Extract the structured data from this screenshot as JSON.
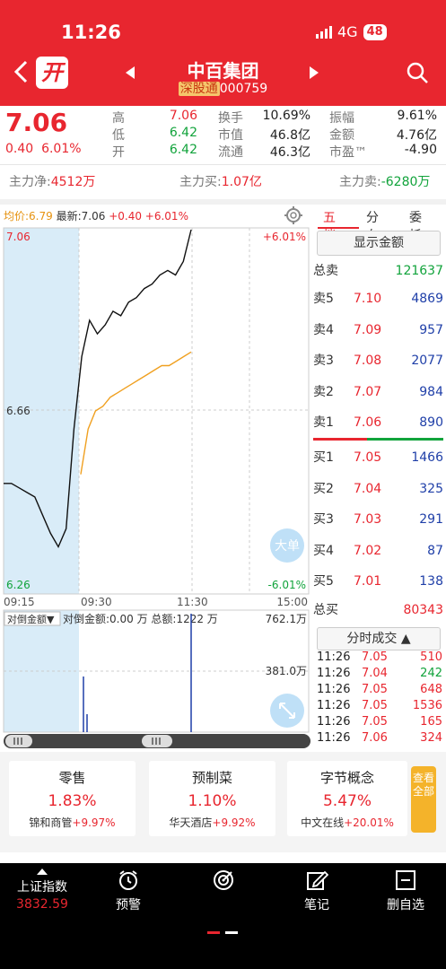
{
  "status": {
    "time": "11:26",
    "network": "4G",
    "battery": "48"
  },
  "header": {
    "logo": "开",
    "name": "中百集团",
    "exchange": "深股通",
    "code": "000759"
  },
  "quote": {
    "price": "7.06",
    "change": "0.40",
    "change_pct": "6.01%",
    "stats": [
      {
        "label": "高",
        "value": "7.06",
        "color": "red"
      },
      {
        "label": "换手",
        "value": "10.69%",
        "color": "black"
      },
      {
        "label": "振幅",
        "value": "9.61%",
        "color": "black"
      },
      {
        "label": "低",
        "value": "6.42",
        "color": "green"
      },
      {
        "label": "市值",
        "value": "46.8亿",
        "color": "black"
      },
      {
        "label": "金额",
        "value": "4.76亿",
        "color": "black"
      },
      {
        "label": "开",
        "value": "6.42",
        "color": "green"
      },
      {
        "label": "流通",
        "value": "46.3亿",
        "color": "black"
      },
      {
        "label": "市盈™",
        "value": "-4.90",
        "color": "black"
      }
    ]
  },
  "capital_flow": {
    "net_label": "主力净:",
    "net_value": "4512万",
    "buy_label": "主力买:",
    "buy_value": "1.07亿",
    "sell_label": "主力卖:",
    "sell_value": "-6280万"
  },
  "chart": {
    "avg_label": "均价:6.79",
    "latest_label": "最新:7.06",
    "chg_label": "+0.40",
    "pct_label": "+6.01%",
    "y_top": "7.06",
    "y_mid": "6.66",
    "y_bottom": "6.26",
    "pct_top": "+6.01%",
    "pct_bottom": "-6.01%",
    "x_labels": [
      "09:15",
      "09:30",
      "11:30",
      "15:00"
    ],
    "enlarge_label": "大单",
    "sub_selector": "对倒金额▼",
    "sub_text": "对倒金额:0.00 万 总额:1222 万",
    "sub_y_top": "762.1万",
    "sub_y_mid": "381.0万"
  },
  "chart_data": {
    "type": "line",
    "title": "",
    "xlabel": "",
    "ylabel": "",
    "ylim": [
      6.26,
      7.06
    ],
    "x_ticks": [
      "09:15",
      "09:30",
      "11:30",
      "15:00"
    ],
    "series": [
      {
        "values": [
          6.5,
          6.5,
          6.49,
          6.48,
          6.47,
          6.43,
          6.39,
          6.36,
          6.4,
          6.62,
          6.78,
          6.86,
          6.83,
          6.85,
          6.88,
          6.87,
          6.9,
          6.91,
          6.93,
          6.94,
          6.96,
          6.97,
          6.96,
          6.99,
          7.06
        ]
      },
      {
        "values": [
          6.52,
          6.62,
          6.66,
          6.67,
          6.69,
          6.7,
          6.71,
          6.72,
          6.73,
          6.74,
          6.75,
          6.76,
          6.76,
          6.77,
          6.78,
          6.79
        ]
      }
    ]
  },
  "orderbook": {
    "tabs": [
      "五档",
      "分布",
      "委托"
    ],
    "show_amount": "显示金额",
    "total_sell_label": "总卖",
    "total_sell": "121637",
    "asks": [
      {
        "label": "卖5",
        "price": "7.10",
        "vol": "4869"
      },
      {
        "label": "卖4",
        "price": "7.09",
        "vol": "957"
      },
      {
        "label": "卖3",
        "price": "7.08",
        "vol": "2077"
      },
      {
        "label": "卖2",
        "price": "7.07",
        "vol": "984"
      },
      {
        "label": "卖1",
        "price": "7.06",
        "vol": "890"
      }
    ],
    "bids": [
      {
        "label": "买1",
        "price": "7.05",
        "vol": "1466"
      },
      {
        "label": "买2",
        "price": "7.04",
        "vol": "325"
      },
      {
        "label": "买3",
        "price": "7.03",
        "vol": "291"
      },
      {
        "label": "买4",
        "price": "7.02",
        "vol": "87"
      },
      {
        "label": "买5",
        "price": "7.01",
        "vol": "138"
      }
    ],
    "total_buy_label": "总买",
    "total_buy": "80343",
    "ticks_label": "分时成交 ▲",
    "ticks": [
      {
        "t": "11:26",
        "p": "7.05",
        "v": "510",
        "vc": "red"
      },
      {
        "t": "11:26",
        "p": "7.04",
        "v": "242",
        "vc": "green"
      },
      {
        "t": "11:26",
        "p": "7.05",
        "v": "648",
        "vc": "red"
      },
      {
        "t": "11:26",
        "p": "7.05",
        "v": "1536",
        "vc": "red"
      },
      {
        "t": "11:26",
        "p": "7.05",
        "v": "165",
        "vc": "red"
      },
      {
        "t": "11:26",
        "p": "7.06",
        "v": "324",
        "vc": "red"
      }
    ]
  },
  "concepts": [
    {
      "name": "零售",
      "pct": "1.83%",
      "stock": "锦和商管",
      "stock_pct": "+9.97%"
    },
    {
      "name": "预制菜",
      "pct": "1.10%",
      "stock": "华天酒店",
      "stock_pct": "+9.92%"
    },
    {
      "name": "字节概念",
      "pct": "5.47%",
      "stock": "中文在线",
      "stock_pct": "+20.01%"
    }
  ],
  "see_all": "查看全部",
  "bottom_nav": {
    "index_name": "上证指数",
    "index_value": "3832.59",
    "items": [
      {
        "label": "预警",
        "icon": "alarm-clock-icon"
      },
      {
        "label": "",
        "icon": "target-icon"
      },
      {
        "label": "笔记",
        "icon": "edit-note-icon"
      },
      {
        "label": "删自选",
        "icon": "minus-box-icon"
      }
    ]
  }
}
